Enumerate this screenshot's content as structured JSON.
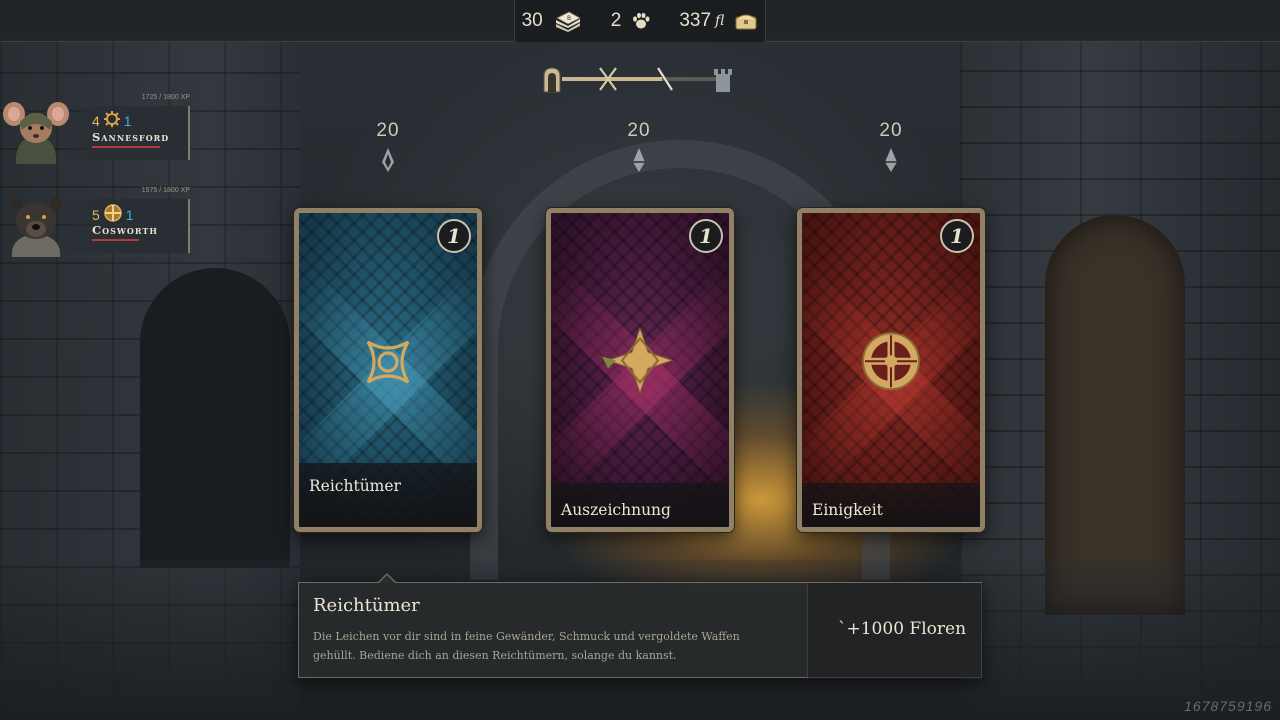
{
  "resources": {
    "items": [
      {
        "value": "30",
        "icon": "book-stack-icon"
      },
      {
        "value": "2",
        "icon": "paw-print-icon"
      },
      {
        "value": "337",
        "unit": "fl",
        "icon": "treasure-chest-icon"
      }
    ]
  },
  "route": {
    "icons": [
      "gate-icon",
      "crossed-swords-icon",
      "sword-icon",
      "tower-icon"
    ]
  },
  "party": [
    {
      "name": "Sannesford",
      "level": "4",
      "blue_stat": "1",
      "xp": "1725 / 1800",
      "xp_unit": "XP",
      "portrait": "mouse-portrait",
      "hp_fraction": 0.95
    },
    {
      "name": "Cosworth",
      "level": "5",
      "blue_stat": "1",
      "xp": "1575 / 1800",
      "xp_unit": "XP",
      "portrait": "badger-portrait",
      "hp_fraction": 0.65
    }
  ],
  "cards": [
    {
      "title": "Reichtümer",
      "cost": "20",
      "count": "1",
      "color": "#1f4e63",
      "emblem": "knot-icon",
      "footer_tall": true
    },
    {
      "title": "Auszeichnung",
      "cost": "20",
      "count": "1",
      "color": "#4c1f3f",
      "emblem": "compass-star-icon",
      "footer_tall": false
    },
    {
      "title": "Einigkeit",
      "cost": "20",
      "count": "1",
      "color": "#6a1f1c",
      "emblem": "celtic-cross-icon",
      "footer_tall": false
    }
  ],
  "tooltip": {
    "title": "Reichtümer",
    "description": "Die Leichen vor dir sind in feine Gewänder, Schmuck und vergoldete Waffen gehüllt. Bediene dich an diesen Reichtümern, solange du kannst.",
    "reward": "`+1000 Floren"
  },
  "seed": "1678759196",
  "colors": {
    "gold": "#c9a15a",
    "accent_blue": "#4fa9e0",
    "hp_red": "#b33a3a"
  }
}
